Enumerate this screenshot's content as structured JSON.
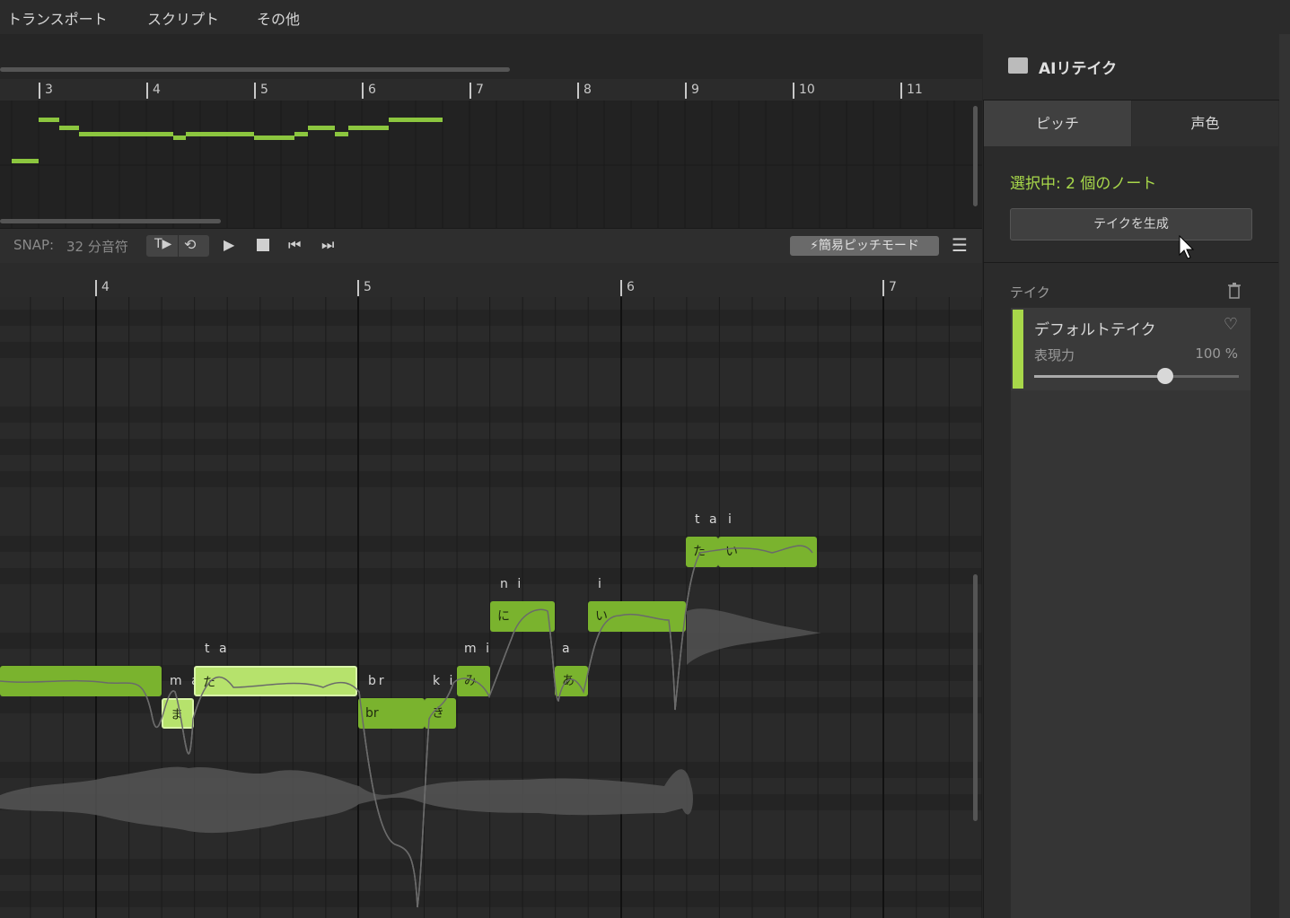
{
  "menu": {
    "items": [
      "トランスポート",
      "スクリプト",
      "その他"
    ]
  },
  "overview": {
    "measures": [
      "3",
      "4",
      "5",
      "6",
      "7",
      "8",
      "9",
      "10",
      "11"
    ]
  },
  "transport": {
    "snap_label": "SNAP:",
    "snap_value": "32 分音符",
    "easy_pitch_mode": "簡易ピッチモード"
  },
  "roll": {
    "measures": [
      "4",
      "5",
      "6",
      "7"
    ],
    "notes": [
      {
        "lyric": "",
        "text": "",
        "selected": false
      },
      {
        "lyric": "m a",
        "text": "ま",
        "selected": true
      },
      {
        "lyric": "t a",
        "text": "た",
        "selected": true
      },
      {
        "lyric": "br",
        "text": "br",
        "selected": false
      },
      {
        "lyric": "k i",
        "text": "き",
        "selected": false
      },
      {
        "lyric": "m i",
        "text": "み",
        "selected": false
      },
      {
        "lyric": "n i",
        "text": "に",
        "selected": false
      },
      {
        "lyric": "a",
        "text": "あ",
        "selected": false
      },
      {
        "lyric": "i",
        "text": "い",
        "selected": false
      },
      {
        "lyric": "t a",
        "text": "た",
        "selected": false
      },
      {
        "lyric": "i",
        "text": "い",
        "selected": false
      }
    ]
  },
  "panel": {
    "title": "AIリテイク",
    "tabs": [
      "ピッチ",
      "声色"
    ],
    "selection_info": "選択中: 2 個のノート",
    "generate_button": "テイクを生成",
    "takes_label": "テイク",
    "take": {
      "name": "デフォルトテイク",
      "expression_label": "表現力",
      "expression_value": "100 %",
      "expression_level": 1.0
    }
  },
  "colors": {
    "accent": "#a8d84a",
    "note": "#7ab32e",
    "note_selected": "#b6e26c",
    "background": "#262626"
  }
}
